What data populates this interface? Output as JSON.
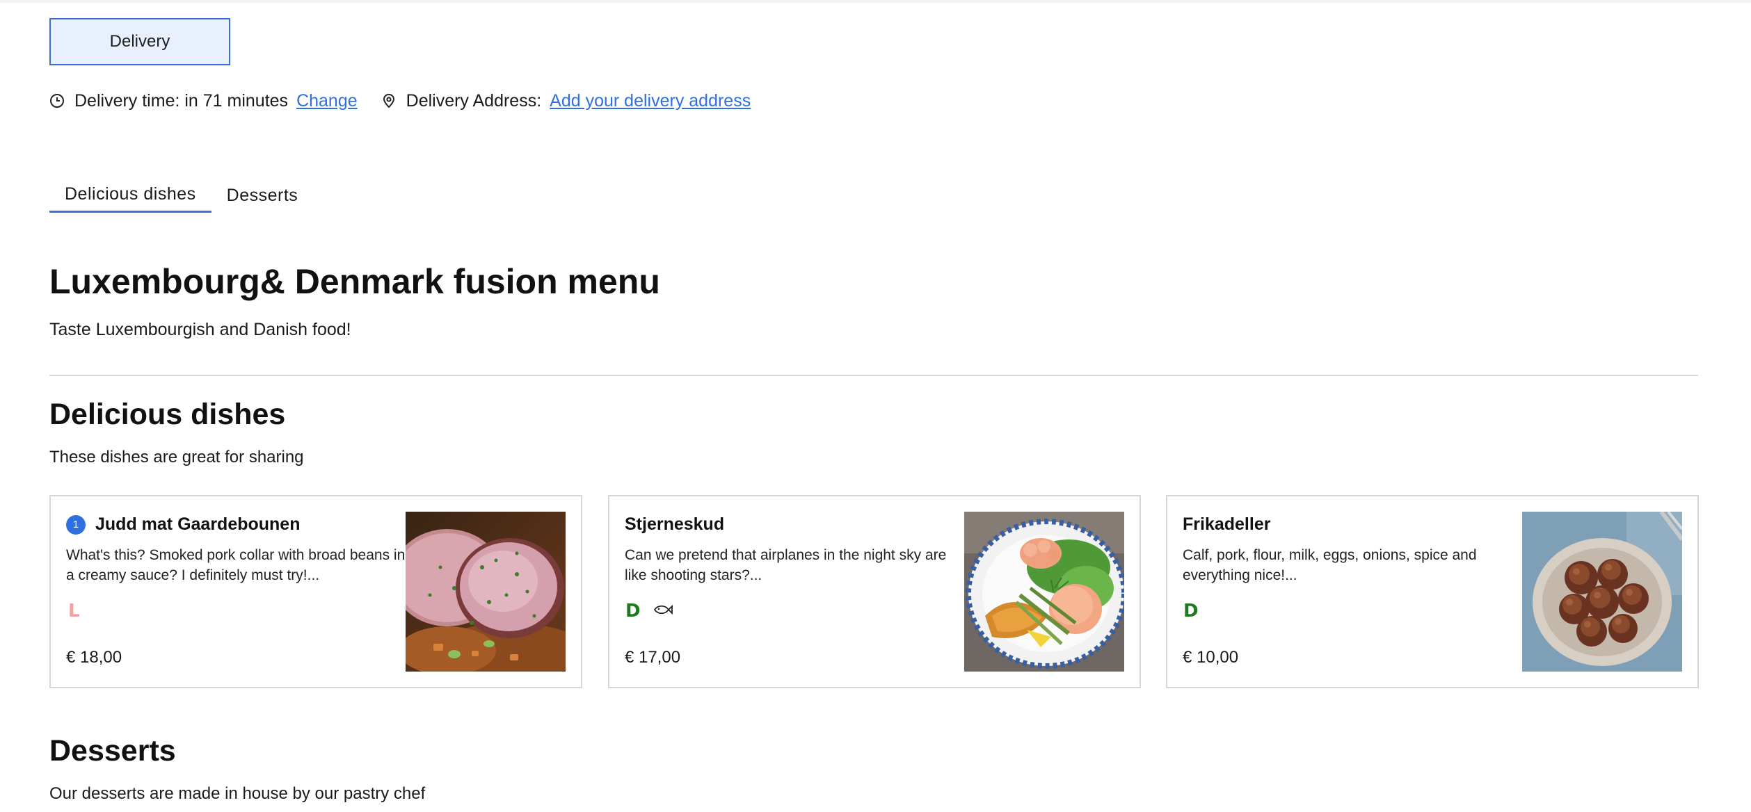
{
  "delivery_button": {
    "label": "Delivery"
  },
  "delivery_info": {
    "time_text": "Delivery time: in 71 minutes",
    "change_link": "Change",
    "address_label": "Delivery Address:",
    "address_link": "Add your delivery address"
  },
  "tabs": [
    {
      "label": "Delicious dishes",
      "active": true
    },
    {
      "label": "Desserts",
      "active": false
    }
  ],
  "menu": {
    "title": "Luxembourg& Denmark fusion menu",
    "subtitle": "Taste Luxembourgish and Danish food!"
  },
  "sections": [
    {
      "title": "Delicious dishes",
      "subtitle": "These dishes are great for sharing",
      "items": [
        {
          "badge": "1",
          "name": "Judd mat Gaardebounen",
          "description": "What's this? Smoked pork collar with broad beans in a creamy sauce? I definitely must try!...",
          "tags": [
            "L"
          ],
          "price": "€ 18,00",
          "image": "smoked-pork-collar-photo"
        },
        {
          "name": "Stjerneskud",
          "description": "Can we pretend that airplanes in the night sky are like shooting stars?...",
          "tags": [
            "D",
            "fish-icon"
          ],
          "price": "€ 17,00",
          "image": "fish-salad-plate-photo"
        },
        {
          "name": "Frikadeller",
          "description": "Calf, pork, flour, milk, eggs, onions, spice and everything nice!...",
          "tags": [
            "D"
          ],
          "price": "€ 10,00",
          "image": "meatballs-plate-photo"
        }
      ]
    },
    {
      "title": "Desserts",
      "subtitle": "Our desserts are made in house by our pastry chef"
    }
  ],
  "colors": {
    "accent": "#2f6fe0",
    "button_bg": "#e8effd",
    "tag_green": "#1f7a1f",
    "tag_pink": "#f2a0a0",
    "divider": "#d6d6d6"
  }
}
